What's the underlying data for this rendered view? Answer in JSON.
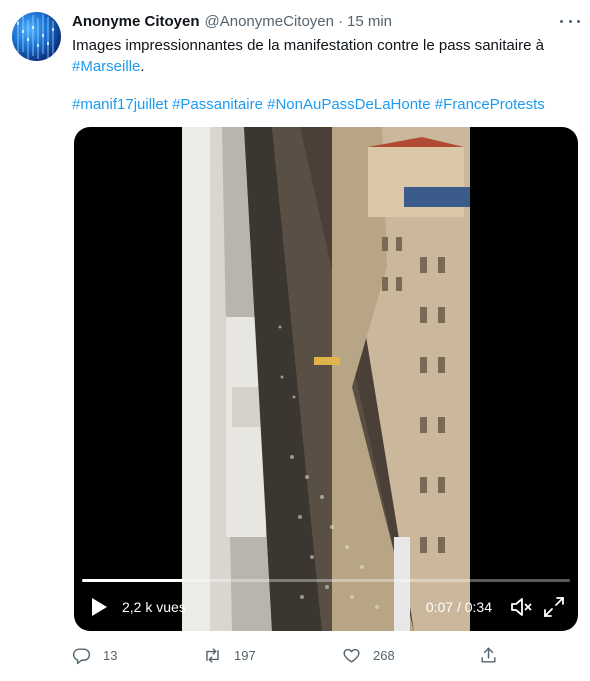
{
  "author": {
    "display_name": "Anonyme Citoyen",
    "handle": "@AnonymeCitoyen",
    "separator": "·",
    "timestamp": "15 min",
    "avatar_icon": "avatar-image"
  },
  "tweet": {
    "text": "Images impressionnantes de la manifestation contre le pass sanitaire à",
    "location_hashtag": "#Marseille",
    "location_suffix": ".",
    "hashtags": [
      "#manif17juillet",
      "#Passanitaire",
      "#NonAuPassDeLaHonte",
      "#FranceProtests"
    ]
  },
  "video": {
    "views": "2,2 k vues",
    "timecode": "0:07 / 0:34",
    "progress": 0.206,
    "play_icon": "play-icon",
    "volume_icon": "volume-icon",
    "fullscreen_icon": "fullscreen-icon"
  },
  "actions": {
    "replies": "13",
    "retweets": "197",
    "likes": "268",
    "reply_icon": "reply-icon",
    "retweet_icon": "retweet-icon",
    "like_icon": "heart-icon",
    "share_icon": "share-icon"
  },
  "colors": {
    "hashtag": "#1d9bf0",
    "secondary_text": "#536471",
    "primary_text": "#0f1419"
  }
}
